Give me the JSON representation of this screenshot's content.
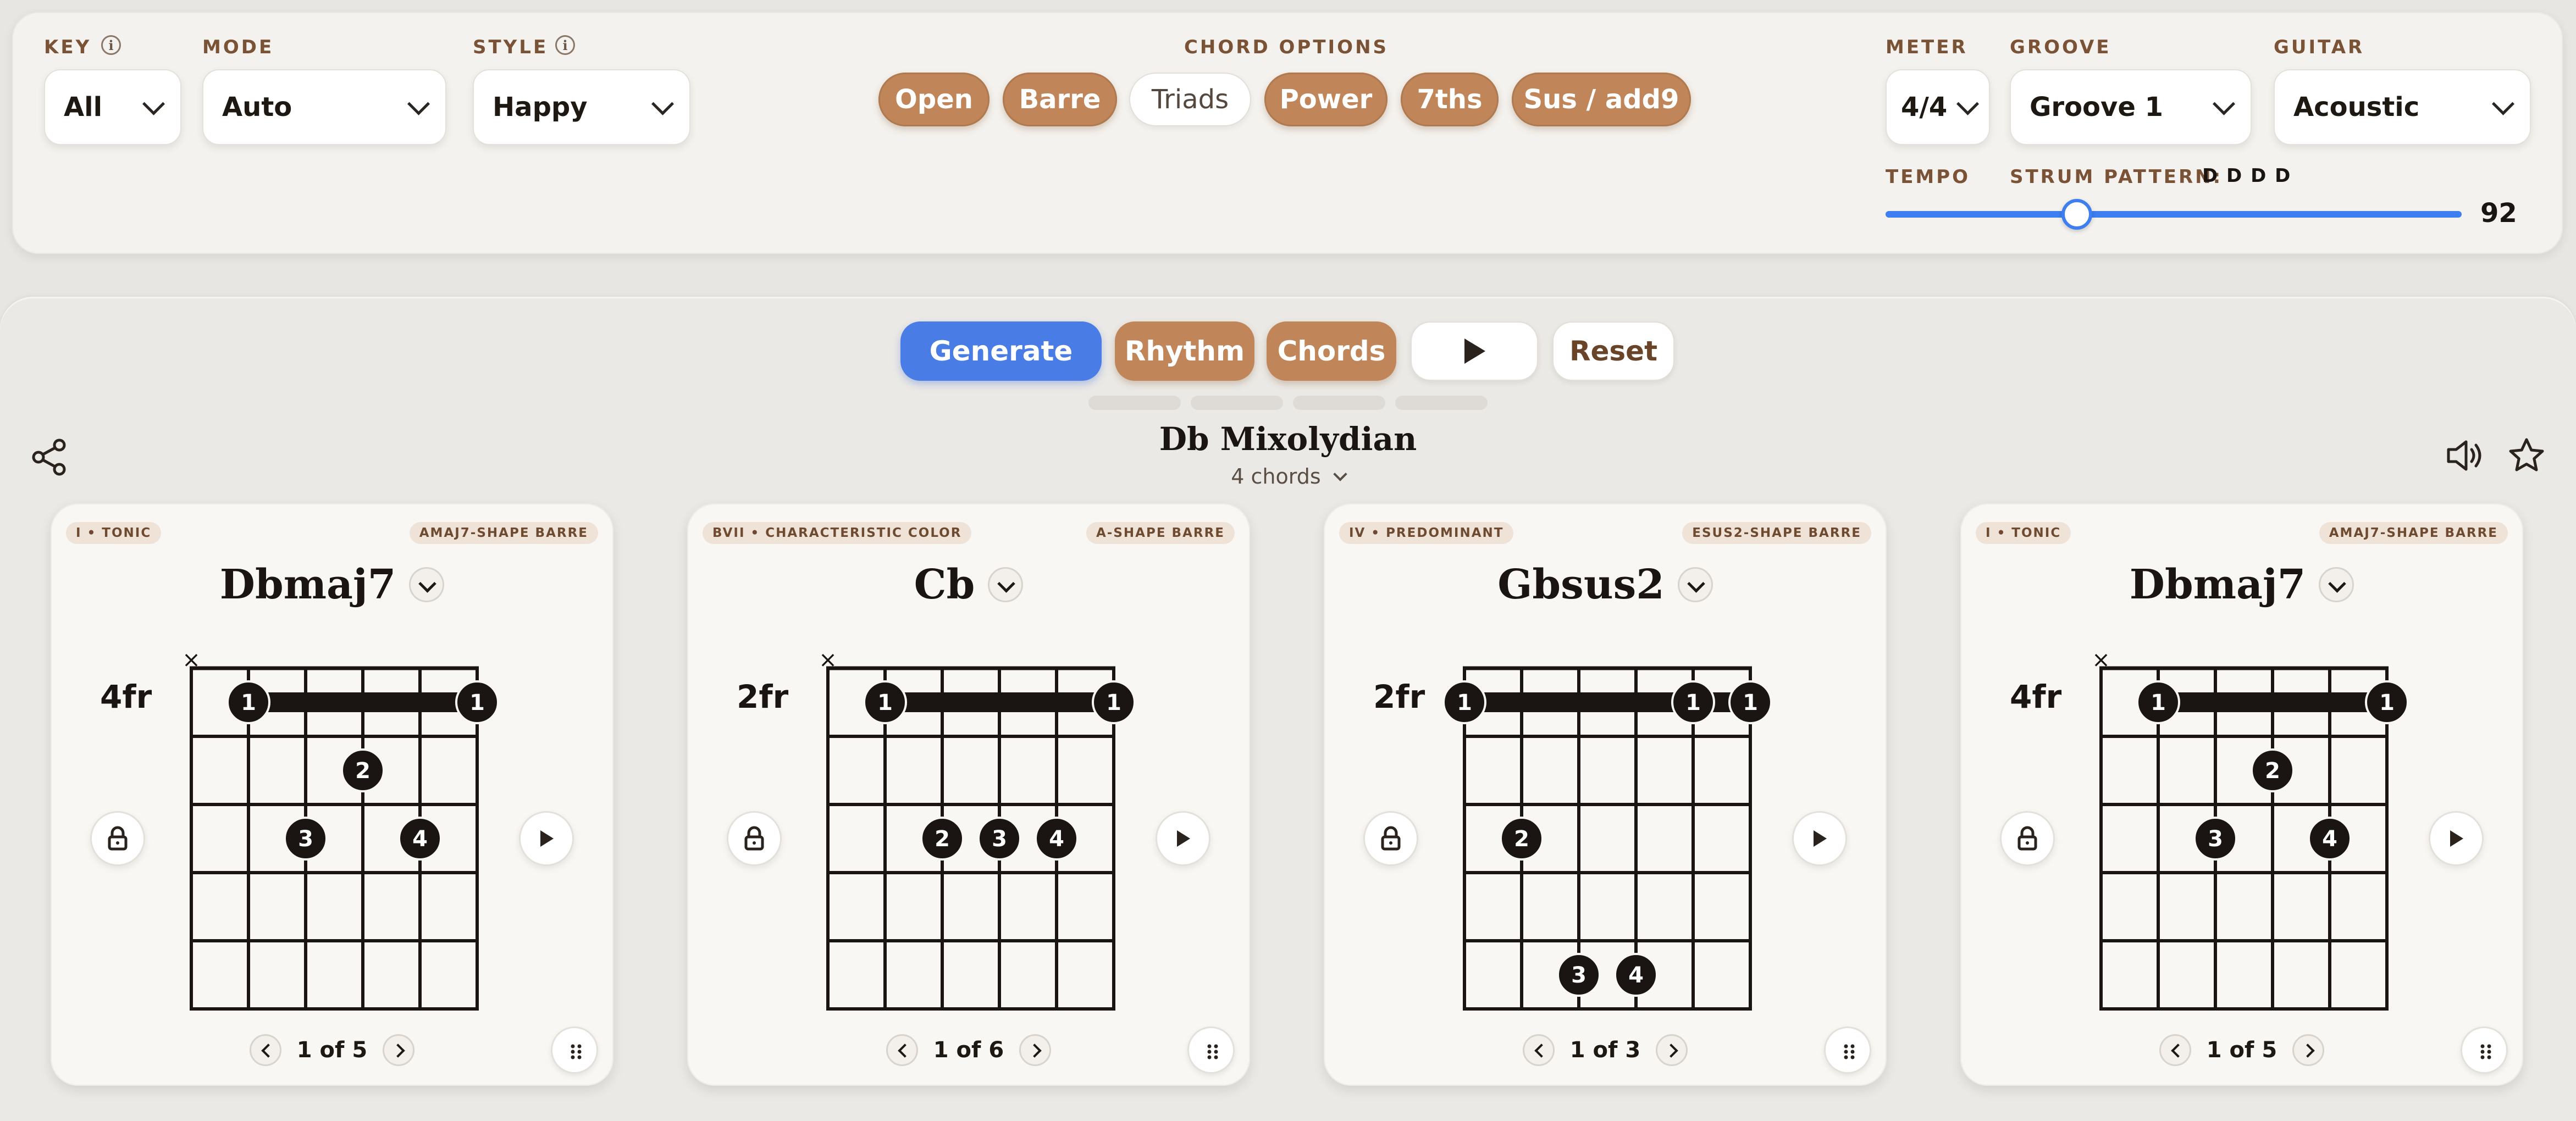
{
  "controls": {
    "key": {
      "label": "KEY",
      "value": "All"
    },
    "mode": {
      "label": "MODE",
      "value": "Auto"
    },
    "style": {
      "label": "STYLE",
      "value": "Happy"
    },
    "chord_options": {
      "label": "CHORD OPTIONS",
      "items": [
        {
          "label": "Open",
          "active": true
        },
        {
          "label": "Barre",
          "active": true
        },
        {
          "label": "Triads",
          "active": false
        },
        {
          "label": "Power",
          "active": true
        },
        {
          "label": "7ths",
          "active": true
        },
        {
          "label": "Sus / add9",
          "active": true
        }
      ]
    },
    "meter": {
      "label": "METER",
      "value": "4/4"
    },
    "groove": {
      "label": "GROOVE",
      "value": "Groove 1"
    },
    "guitar": {
      "label": "GUITAR",
      "value": "Acoustic"
    },
    "tempo": {
      "label": "TEMPO",
      "value": "92",
      "min_hint": null
    },
    "strum": {
      "label": "STRUM PATTERN:",
      "pattern": "D D D D"
    }
  },
  "actions": {
    "generate": "Generate",
    "rhythm": "Rhythm",
    "chords": "Chords",
    "reset": "Reset"
  },
  "progression": {
    "title": "Db Mixolydian",
    "count_label": "4 chords"
  },
  "colors": {
    "accent_tan": "#c08659",
    "accent_blue": "#4a7ce6"
  },
  "cards": [
    {
      "function_tag": "I • TONIC",
      "shape_tag": "AMAJ7-SHAPE BARRE",
      "name": "Dbmaj7",
      "fret_label": "4fr",
      "muted_strings": [
        0
      ],
      "barre": {
        "fret": 1,
        "from": 1,
        "to": 5,
        "finger": "1"
      },
      "notes": [
        {
          "string": 3,
          "fret": 2,
          "finger": "2"
        },
        {
          "string": 2,
          "fret": 3,
          "finger": "3"
        },
        {
          "string": 4,
          "fret": 3,
          "finger": "4"
        }
      ],
      "pager": "1 of 5"
    },
    {
      "function_tag": "BVII • CHARACTERISTIC COLOR",
      "shape_tag": "A-SHAPE BARRE",
      "name": "Cb",
      "fret_label": "2fr",
      "muted_strings": [
        0
      ],
      "barre": {
        "fret": 1,
        "from": 1,
        "to": 5,
        "finger": "1"
      },
      "notes": [
        {
          "string": 2,
          "fret": 3,
          "finger": "2"
        },
        {
          "string": 3,
          "fret": 3,
          "finger": "3"
        },
        {
          "string": 4,
          "fret": 3,
          "finger": "4"
        }
      ],
      "pager": "1 of 6"
    },
    {
      "function_tag": "IV • PREDOMINANT",
      "shape_tag": "ESUS2-SHAPE BARRE",
      "name": "Gbsus2",
      "fret_label": "2fr",
      "muted_strings": [],
      "barre": {
        "fret": 1,
        "from": 0,
        "to": 5,
        "finger": "1"
      },
      "notes": [
        {
          "string": 1,
          "fret": 3,
          "finger": "2"
        },
        {
          "string": 2,
          "fret": 5,
          "finger": "3"
        },
        {
          "string": 3,
          "fret": 5,
          "finger": "4"
        }
      ],
      "barre_extra": [
        4
      ],
      "pager": "1 of 3"
    },
    {
      "function_tag": "I • TONIC",
      "shape_tag": "AMAJ7-SHAPE BARRE",
      "name": "Dbmaj7",
      "fret_label": "4fr",
      "muted_strings": [
        0
      ],
      "barre": {
        "fret": 1,
        "from": 1,
        "to": 5,
        "finger": "1"
      },
      "notes": [
        {
          "string": 3,
          "fret": 2,
          "finger": "2"
        },
        {
          "string": 2,
          "fret": 3,
          "finger": "3"
        },
        {
          "string": 4,
          "fret": 3,
          "finger": "4"
        }
      ],
      "pager": "1 of 5"
    }
  ]
}
